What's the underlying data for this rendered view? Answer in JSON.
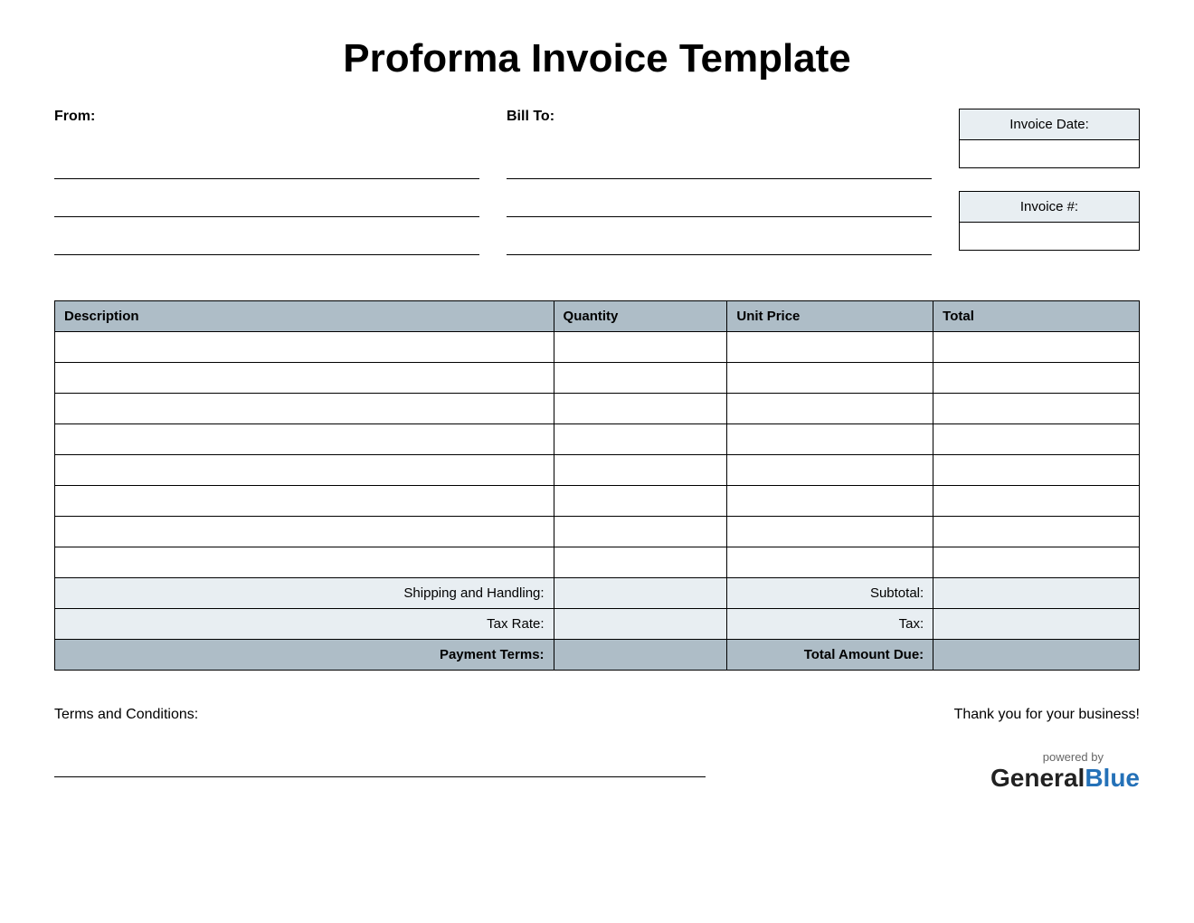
{
  "title": "Proforma Invoice Template",
  "from_label": "From:",
  "billto_label": "Bill To:",
  "meta": {
    "date_label": "Invoice Date:",
    "date_value": "",
    "number_label": "Invoice #:",
    "number_value": ""
  },
  "table": {
    "headers": {
      "description": "Description",
      "quantity": "Quantity",
      "unit_price": "Unit Price",
      "total": "Total"
    },
    "rows": [
      {
        "description": "",
        "quantity": "",
        "unit_price": "",
        "total": ""
      },
      {
        "description": "",
        "quantity": "",
        "unit_price": "",
        "total": ""
      },
      {
        "description": "",
        "quantity": "",
        "unit_price": "",
        "total": ""
      },
      {
        "description": "",
        "quantity": "",
        "unit_price": "",
        "total": ""
      },
      {
        "description": "",
        "quantity": "",
        "unit_price": "",
        "total": ""
      },
      {
        "description": "",
        "quantity": "",
        "unit_price": "",
        "total": ""
      },
      {
        "description": "",
        "quantity": "",
        "unit_price": "",
        "total": ""
      },
      {
        "description": "",
        "quantity": "",
        "unit_price": "",
        "total": ""
      }
    ],
    "summary": {
      "shipping_label": "Shipping and Handling:",
      "shipping_value": "",
      "subtotal_label": "Subtotal:",
      "subtotal_value": "",
      "taxrate_label": "Tax Rate:",
      "taxrate_value": "",
      "tax_label": "Tax:",
      "tax_value": "",
      "terms_label": "Payment Terms:",
      "terms_value": "",
      "totaldue_label": "Total Amount Due:",
      "totaldue_value": ""
    }
  },
  "footer": {
    "terms_label": "Terms and Conditions:",
    "thanks": "Thank you for your business!",
    "powered": "powered by",
    "brand1": "General",
    "brand2": "Blue"
  }
}
